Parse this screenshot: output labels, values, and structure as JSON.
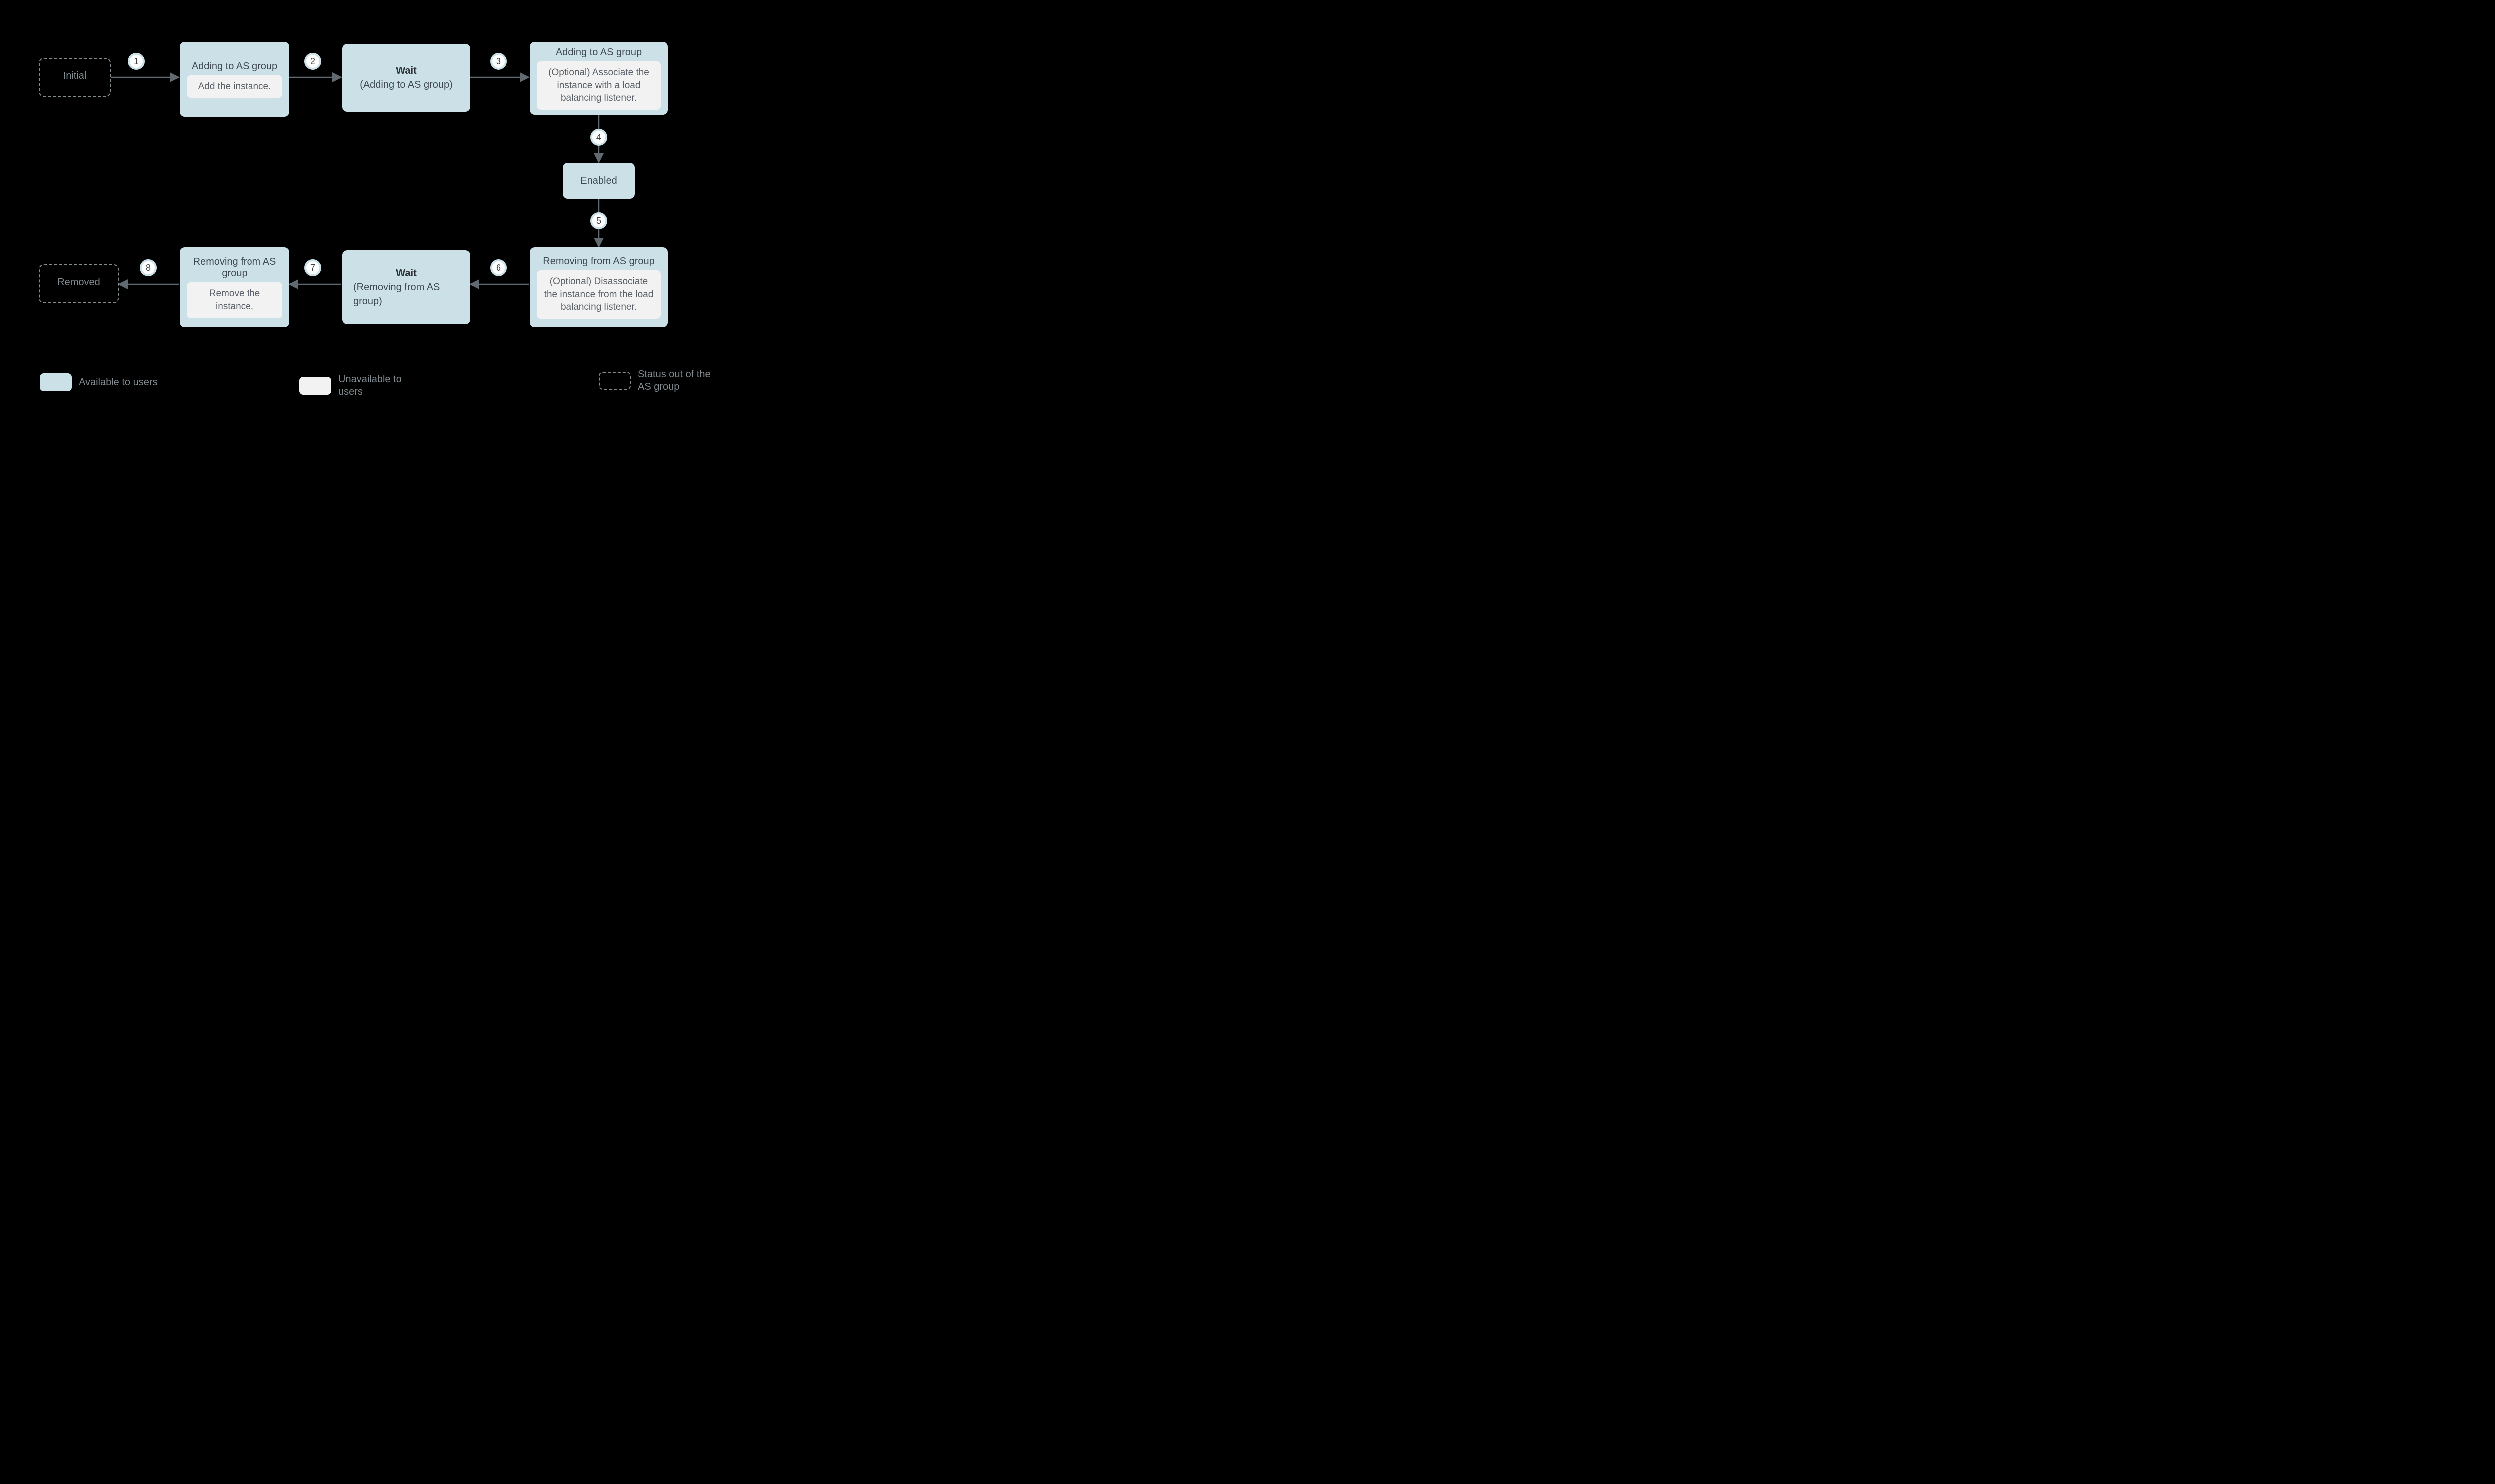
{
  "nodes": {
    "initial": {
      "label": "Initial"
    },
    "adding1": {
      "title": "Adding to AS group",
      "sub": "Add the instance."
    },
    "wait_add": {
      "line1": "Wait",
      "line2": "(Adding to AS group)"
    },
    "adding2": {
      "title": "Adding to AS group",
      "sub": "(Optional) Associate the instance with a load balancing listener."
    },
    "enabled": {
      "label": "Enabled"
    },
    "removing1": {
      "title": "Removing from AS group",
      "sub": "(Optional) Disassociate the instance from the load balancing listener."
    },
    "wait_remove": {
      "line1": "Wait",
      "line2": "(Removing from AS group)"
    },
    "removing2": {
      "title": "Removing from AS group",
      "sub": "Remove the instance."
    },
    "removed": {
      "label": "Removed"
    }
  },
  "steps": {
    "s1": "1",
    "s2": "2",
    "s3": "3",
    "s4": "4",
    "s5": "5",
    "s6": "6",
    "s7": "7",
    "s8": "8"
  },
  "legend": {
    "available": "Available to users",
    "unavailable": "Unavailable to users",
    "outside": "Status out of the AS group"
  },
  "colors": {
    "box": "#cce0e8",
    "subbox": "#f2f2f2",
    "dash": "#808a8f",
    "arrow": "#606a70"
  }
}
